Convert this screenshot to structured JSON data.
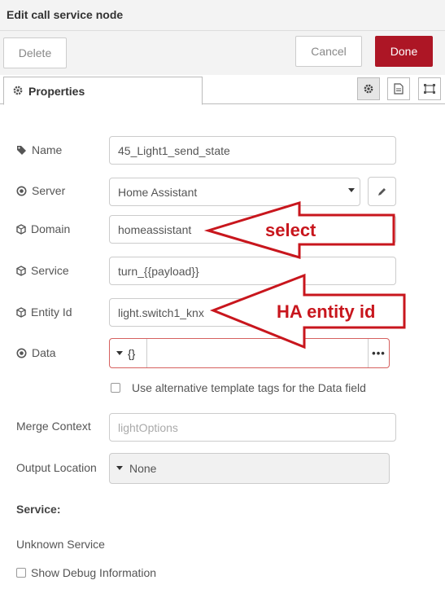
{
  "header": {
    "title": "Edit call service node"
  },
  "toolbar": {
    "delete_label": "Delete",
    "cancel_label": "Cancel",
    "done_label": "Done"
  },
  "tabs": {
    "properties_label": "Properties"
  },
  "fields": {
    "name": {
      "label": "Name",
      "value": "45_Light1_send_state"
    },
    "server": {
      "label": "Server",
      "value": "Home Assistant"
    },
    "domain": {
      "label": "Domain",
      "value": "homeassistant"
    },
    "service": {
      "label": "Service",
      "value": "turn_{{payload}}"
    },
    "entity_id": {
      "label": "Entity Id",
      "value": "light.switch1_knx"
    },
    "data": {
      "label": "Data",
      "type_value": "{}",
      "more": "•••"
    },
    "alt_template": {
      "label": "Use alternative template tags for the Data field"
    },
    "merge_context": {
      "label": "Merge Context",
      "placeholder": "lightOptions"
    },
    "output_location": {
      "label": "Output Location",
      "value": "None"
    }
  },
  "service_section": {
    "title": "Service:",
    "value": "Unknown Service"
  },
  "debug": {
    "label": "Show Debug Information"
  },
  "annotations": {
    "select": "select",
    "entity": "HA entity id",
    "color": "#c8161d"
  },
  "colors": {
    "done": "#ad1625",
    "error_border": "#d6615f"
  }
}
